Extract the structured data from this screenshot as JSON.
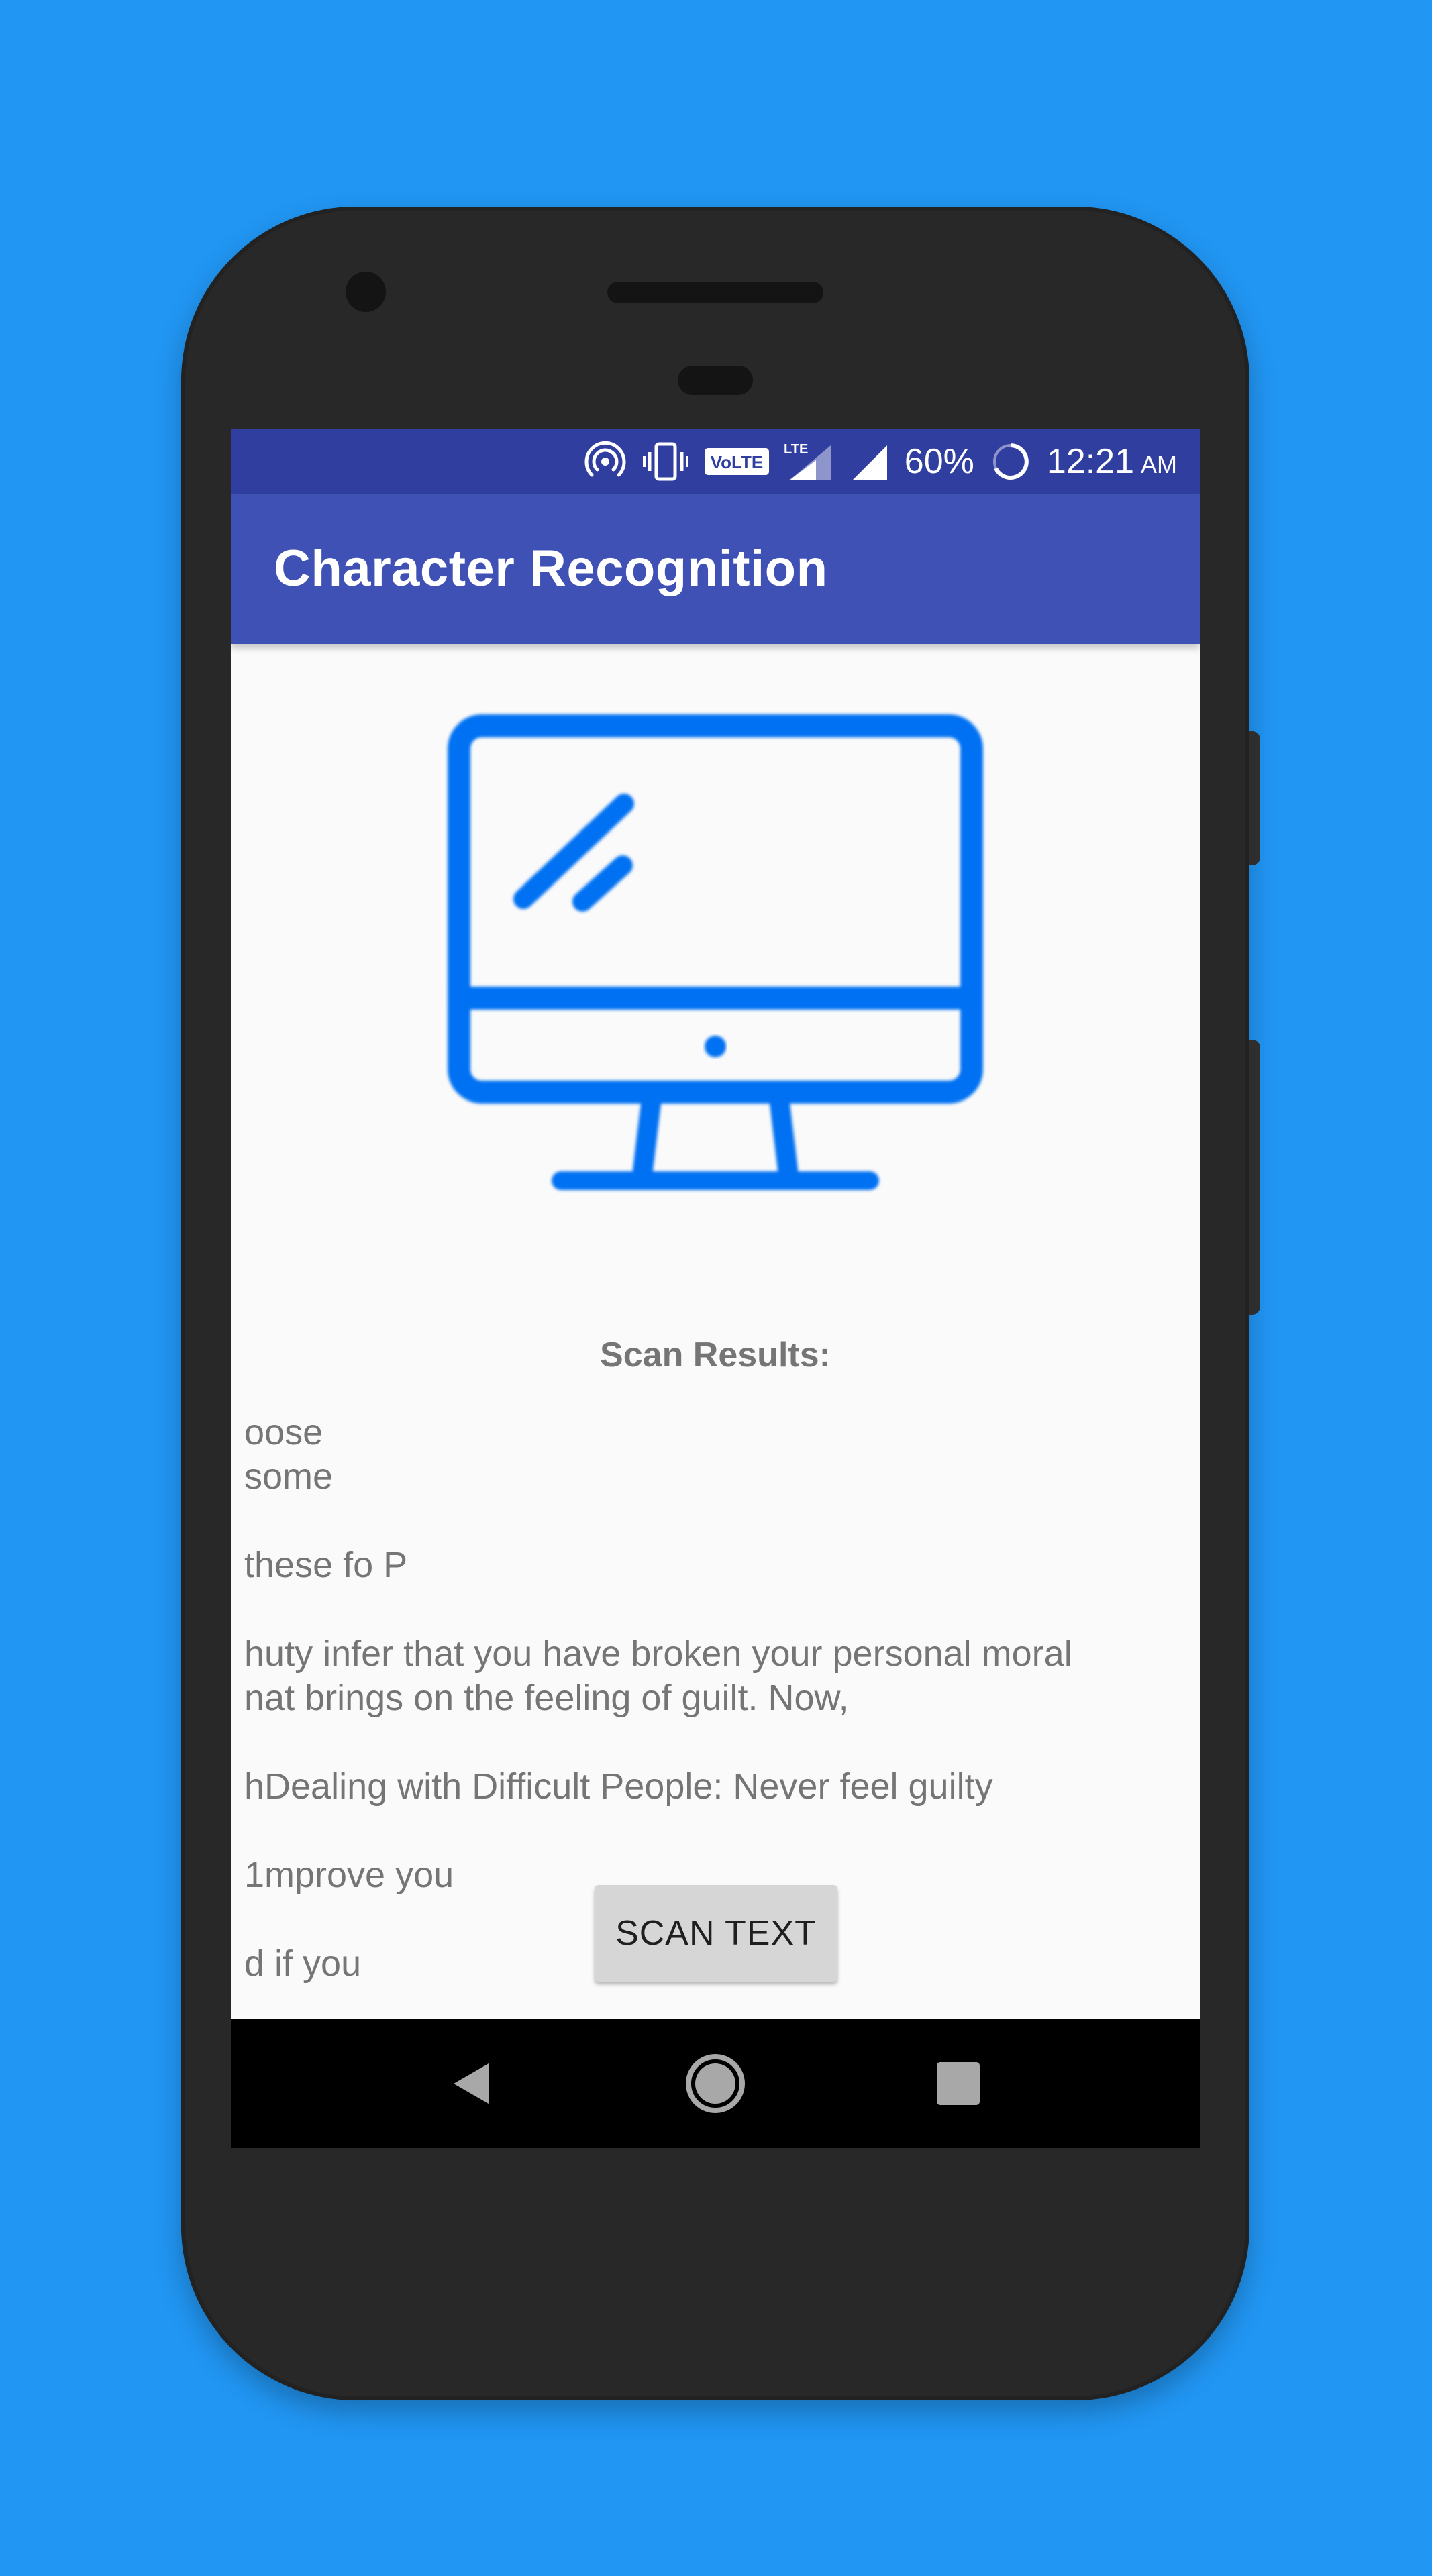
{
  "status_bar": {
    "battery": "60%",
    "time": "12:21",
    "ampm": "AM",
    "volte": "VoLTE",
    "lte": "LTE",
    "icons": [
      "hotspot-icon",
      "vibrate-icon",
      "volte-icon",
      "lte-signal-icon",
      "signal-icon",
      "battery-icon"
    ]
  },
  "app_bar": {
    "title": "Character Recognition"
  },
  "main": {
    "image_icon": "monitor-icon",
    "scan_results_label": "Scan Results:",
    "results_text": "oose\nsome\n\nthese fo P\n\nhuty infer that you have broken your personal moral\nnat brings on the feeling of guilt. Now,\n\nhDealing with Difficult People: Never feel guilty\n\n1mprove you\n\nd if you",
    "scan_button_label": "SCAN TEXT"
  },
  "nav_bar": {
    "icons": [
      "back-icon",
      "home-icon",
      "recents-icon"
    ]
  },
  "colors": {
    "background": "#2196F3",
    "status_bar": "#303F9F",
    "app_bar": "#3F51B5",
    "icon_blue": "#0071F2",
    "text_gray": "#757575"
  }
}
